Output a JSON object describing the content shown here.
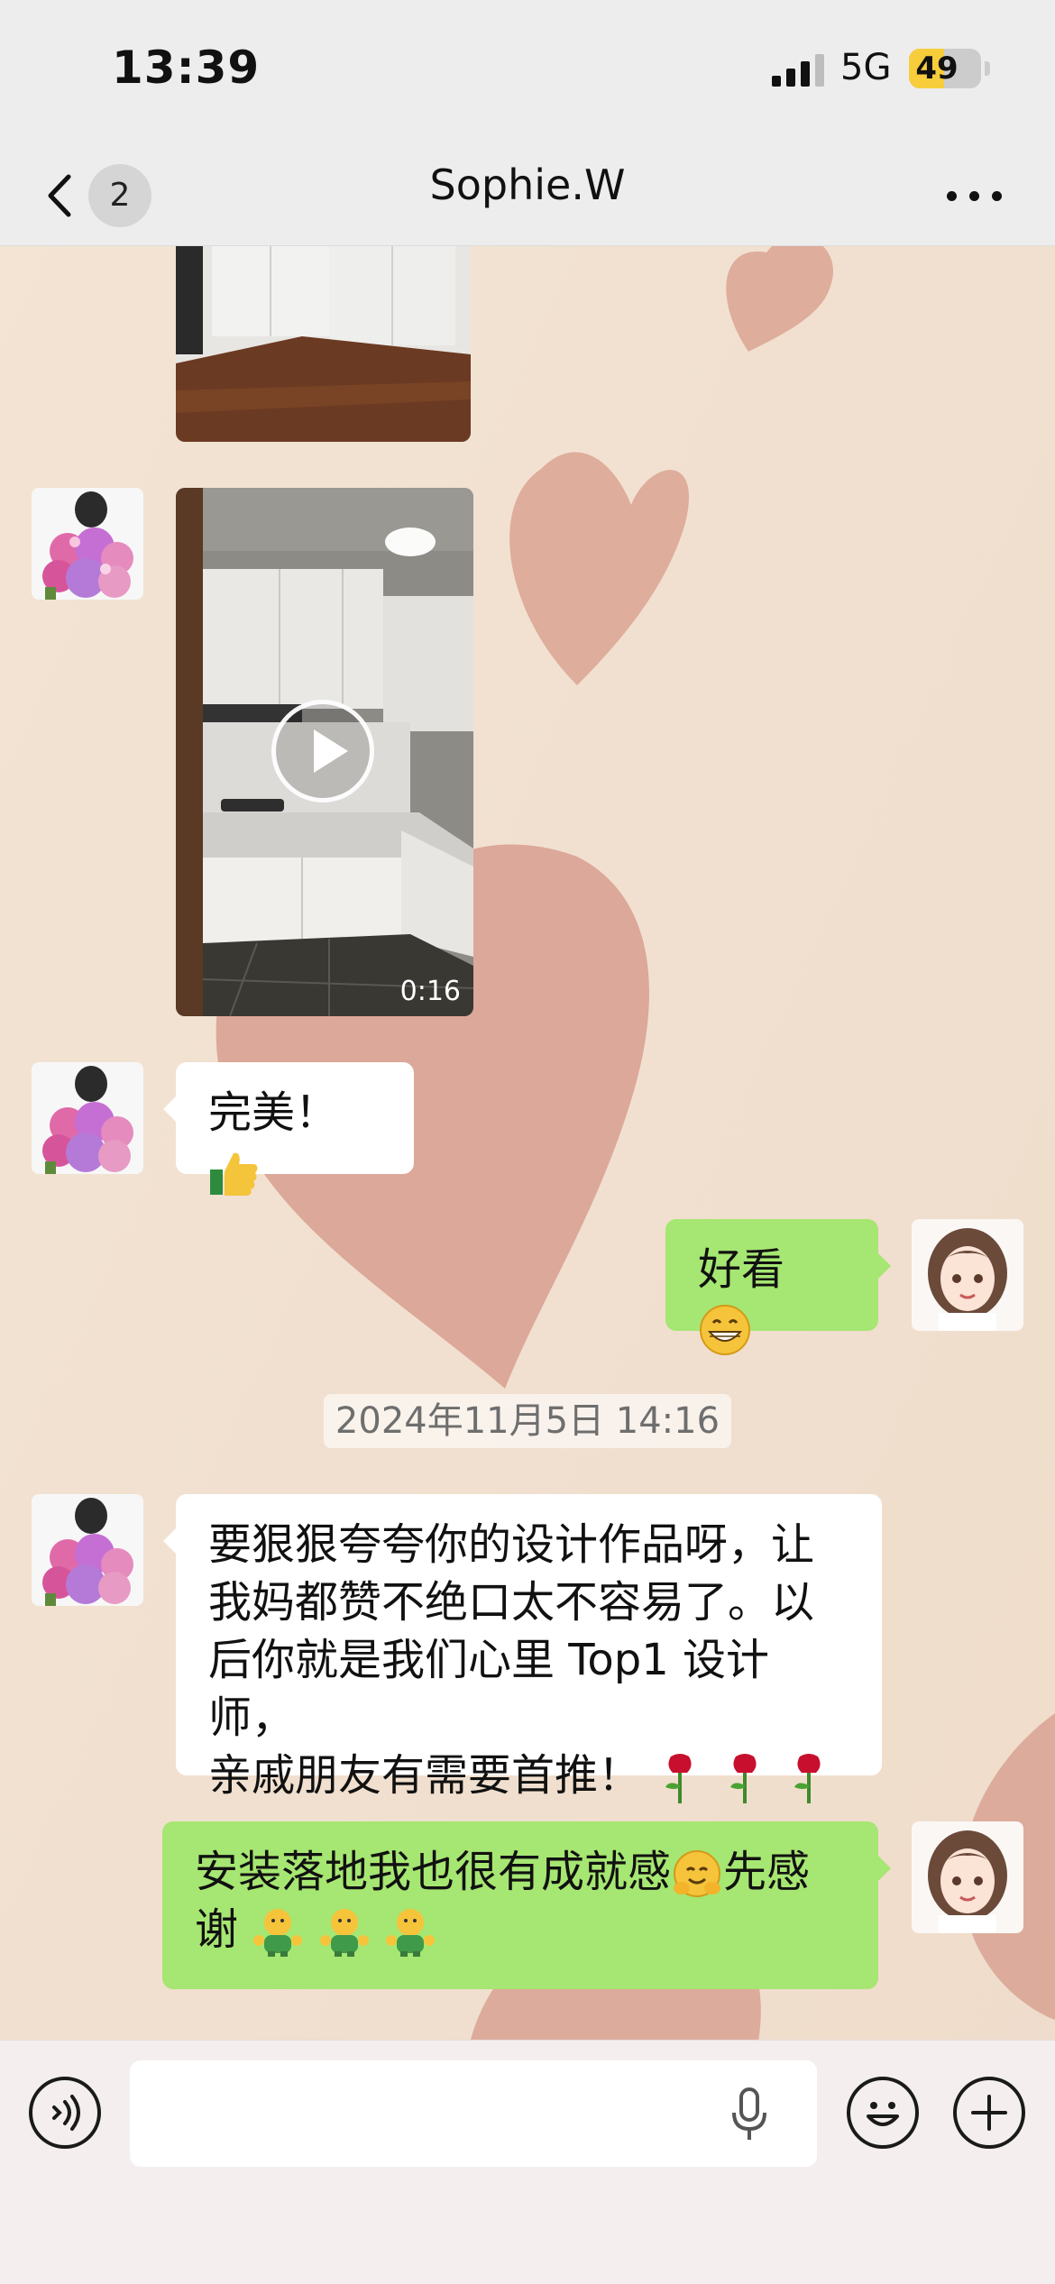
{
  "status_bar": {
    "time": "13:39",
    "network": "5G",
    "battery": "49",
    "battery_level": 0.49
  },
  "nav": {
    "unread_count": "2",
    "title": "Sophie.W",
    "back_icon": "chevron-left-icon",
    "more_icon": "ellipsis-icon"
  },
  "messages": [
    {
      "type": "image",
      "sender": "Sophie.W",
      "media_icon": "photo-thumbnail"
    },
    {
      "type": "video",
      "sender": "Sophie.W",
      "duration": "0:16"
    },
    {
      "type": "text",
      "sender": "Sophie.W",
      "text": "完美！"
    },
    {
      "type": "text",
      "sender": "me",
      "text": "好看"
    },
    {
      "type": "timestamp",
      "text": "2024年11月5日 14:16"
    },
    {
      "type": "text",
      "sender": "Sophie.W",
      "lines": [
        "要狠狠夸夸你的设计作品呀，让",
        "我妈都赞不绝口太不容易了。以",
        "后你就是我们心里 Top1 设计师，",
        "亲戚朋友有需要首推！"
      ]
    },
    {
      "type": "text",
      "sender": "me",
      "lines": [
        "安装落地我也很有成就感",
        "先感",
        "谢"
      ]
    }
  ],
  "input_bar": {
    "placeholder": "",
    "voice_icon": "voice-toggle-icon",
    "mic_icon": "microphone-icon",
    "emoji_icon": "emoji-icon",
    "plus_icon": "plus-icon"
  },
  "colors": {
    "outgoing_bubble": "#a6e672",
    "incoming_bubble": "#ffffff",
    "nav_background": "#ededed",
    "wallpaper": "#f1e3d5",
    "hearts": "#d8a394"
  }
}
